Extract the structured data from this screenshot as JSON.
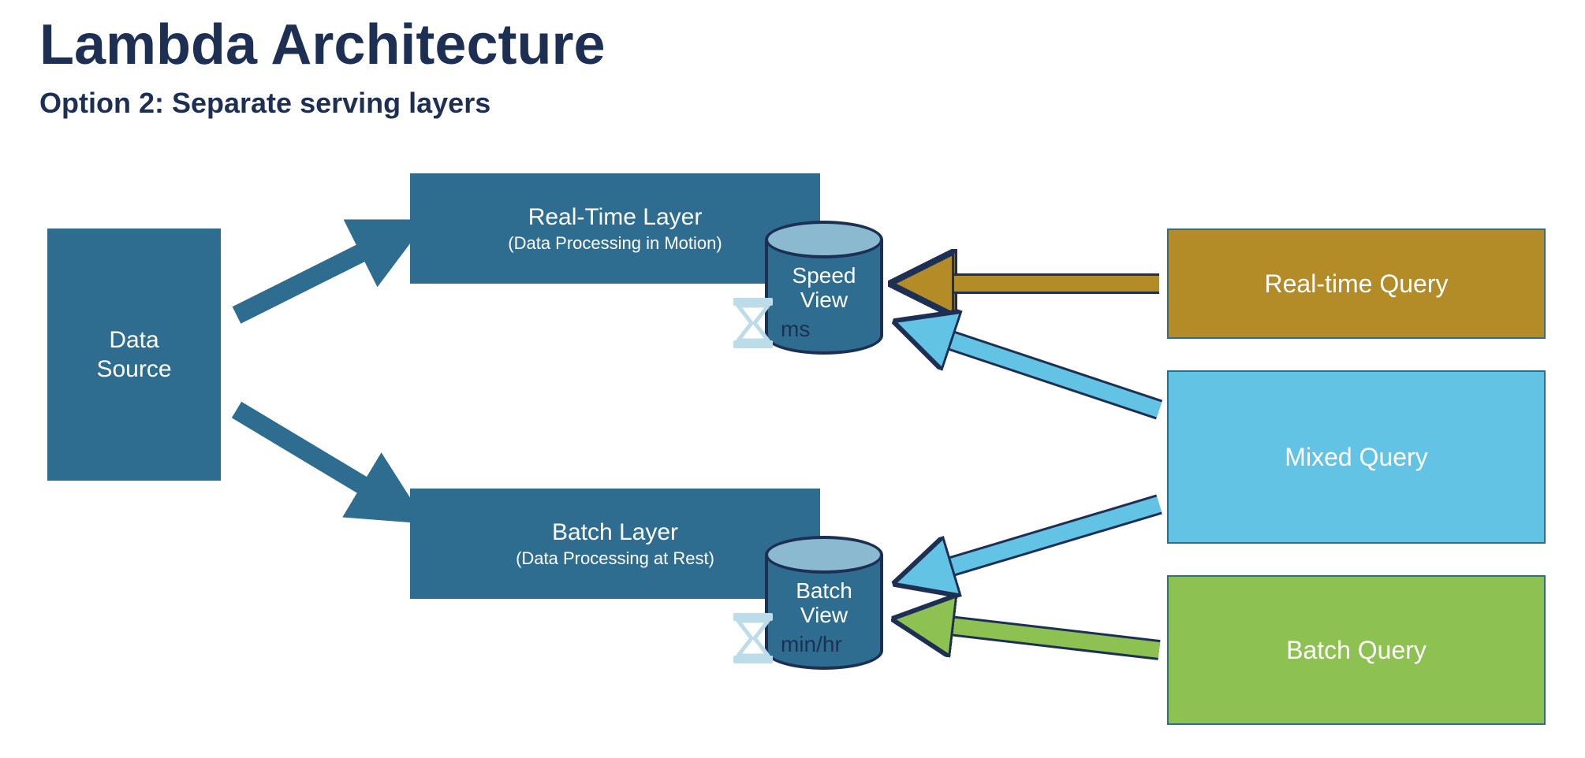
{
  "title": "Lambda Architecture",
  "subtitle": "Option 2: Separate serving layers",
  "data_source": {
    "label": "Data\nSource"
  },
  "realtime_layer": {
    "title": "Real-Time Layer",
    "subtitle": "(Data Processing in Motion)",
    "time_label": "ms"
  },
  "batch_layer": {
    "title": "Batch Layer",
    "subtitle": "(Data Processing at Rest)",
    "time_label": "min/hr"
  },
  "speed_view": {
    "label": "Speed\nView"
  },
  "batch_view": {
    "label": "Batch\nView"
  },
  "queries": {
    "realtime": "Real-time Query",
    "mixed": "Mixed Query",
    "batch": "Batch Query"
  },
  "colors": {
    "dark_navy": "#1d3054",
    "teal": "#2e6d8f",
    "light_teal": "#8bbad0",
    "gold": "#b38b27",
    "sky": "#62c3e4",
    "green": "#8dc253",
    "hourglass": "#bcdce9"
  }
}
